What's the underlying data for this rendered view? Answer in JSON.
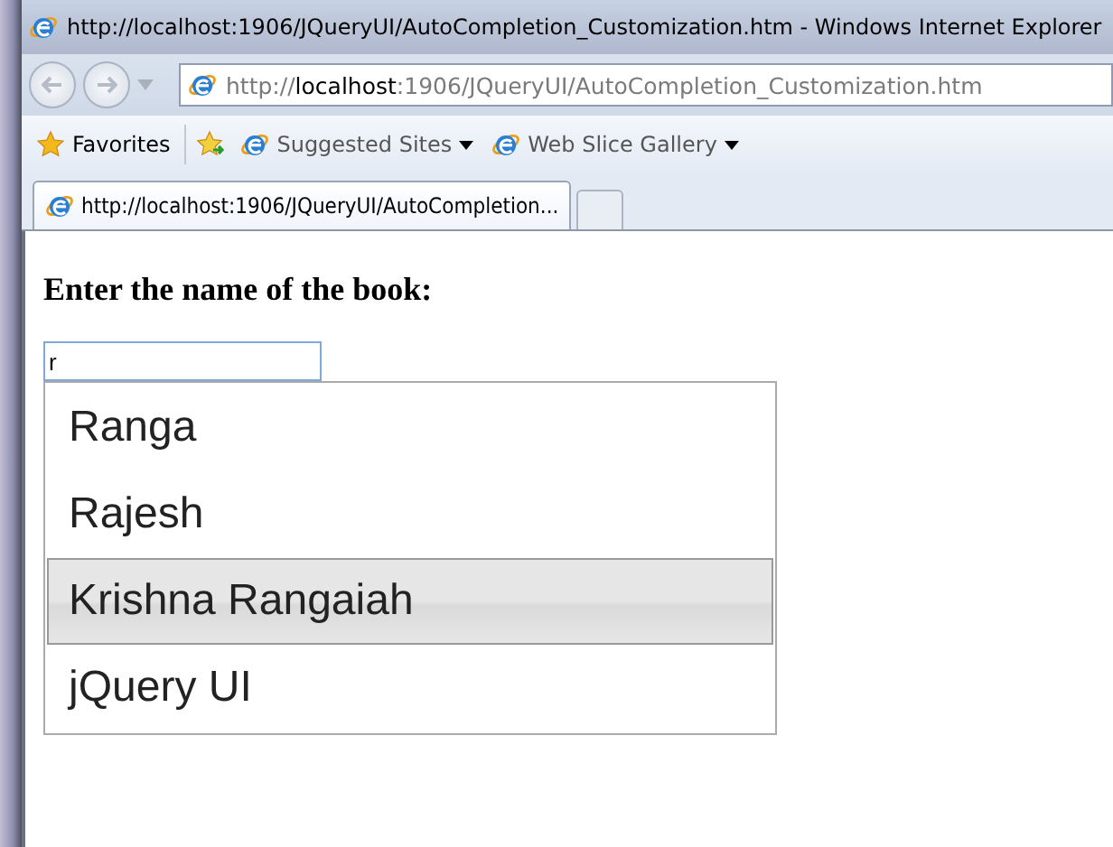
{
  "window": {
    "title": "http://localhost:1906/JQueryUI/AutoCompletion_Customization.htm - Windows Internet Explorer"
  },
  "address_bar": {
    "url": "http://**localhost**:1906/JQueryUI/AutoCompletion_Customization.htm"
  },
  "favorites_bar": {
    "favorites": "Favorites",
    "links": [
      {
        "label": "Suggested Sites",
        "has_menu": true
      },
      {
        "label": "Web Slice Gallery",
        "has_menu": true
      }
    ]
  },
  "tabs": [
    {
      "label": "http://localhost:1906/JQueryUI/AutoCompletion...",
      "selected": true
    }
  ],
  "page": {
    "heading": "Enter the name of the book:",
    "search": {
      "value": "r"
    },
    "suggestions": [
      {
        "label": "Ranga",
        "selected": false
      },
      {
        "label": "Rajesh",
        "selected": false
      },
      {
        "label": "Krishna Rangaiah",
        "selected": true
      },
      {
        "label": "jQuery UI",
        "selected": false
      }
    ]
  }
}
